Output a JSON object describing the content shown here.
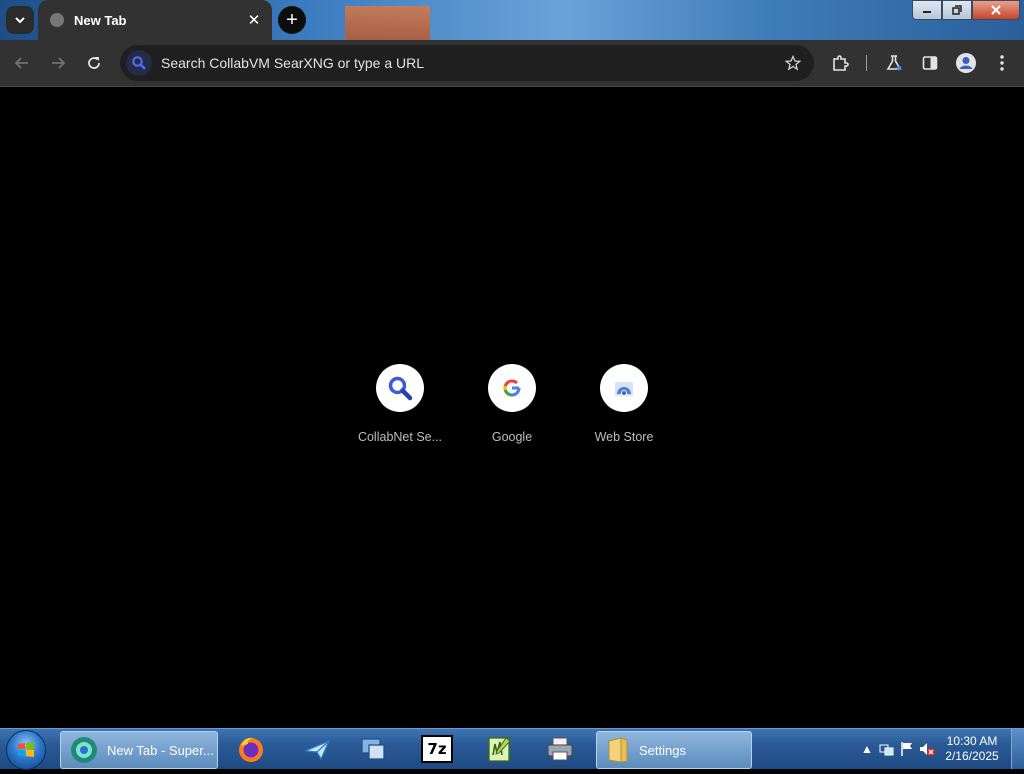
{
  "browser": {
    "tab": {
      "title": "New Tab",
      "close_glyph": "✕"
    },
    "new_tab_glyph": "+",
    "omnibox_placeholder": "Search CollabVM SearXNG or type a URL"
  },
  "shortcuts": [
    {
      "label": "CollabNet Se..."
    },
    {
      "label": "Google"
    },
    {
      "label": "Web Store"
    }
  ],
  "taskbar": {
    "chrome_task_label": "New Tab - Super...",
    "settings_task_label": "Settings",
    "clock_time": "10:30 AM",
    "clock_date": "2/16/2025",
    "sevenzip_label": "7z"
  },
  "colors": {
    "accent_search": "#3c5cd8",
    "toolbar_bg": "#323232",
    "page_bg": "#000000"
  }
}
